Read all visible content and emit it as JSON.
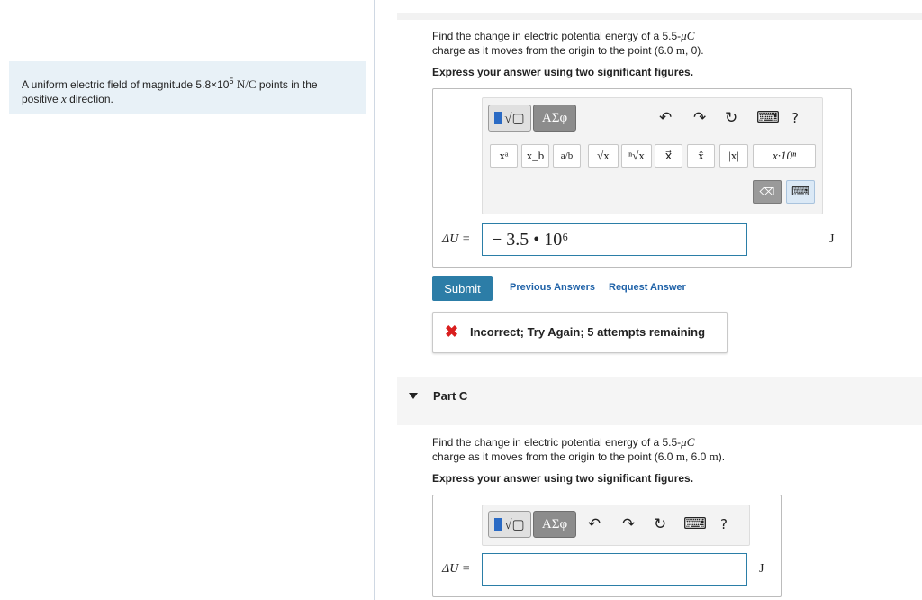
{
  "intro": {
    "text_before": "A uniform electric field of magnitude 5.8×10",
    "exponent": "5",
    "unit": "N/C",
    "text_after": " points in the positive ",
    "variable": "x",
    "text_end": " direction."
  },
  "part_b": {
    "question_line1_pre": "Find the change in electric potential energy of a 5.5-",
    "question_charge_unit": "μC",
    "question_line2_pre": "charge as it moves from the origin to the point (6.0 ",
    "question_m": "m",
    "question_line2_post": ", 0).",
    "instruction": "Express your answer using two significant figures.",
    "toolbar": {
      "format_symbol": "√▢",
      "greek": "ΑΣφ",
      "undo": "↶",
      "redo": "↷",
      "reset": "↻",
      "keyboard": "⌨",
      "help": "?",
      "templates": [
        "xᵃ",
        "x_b",
        "a/b",
        "√x",
        "ⁿ√x",
        "x⃗",
        "x̂",
        "|x|",
        "x·10ⁿ"
      ],
      "delete": "⌫",
      "keyboard_up": "⌨"
    },
    "answer_label": "ΔU =",
    "answer_value": "− 3.5 • 10⁶",
    "answer_unit": "J",
    "submit": "Submit",
    "previous_answers": "Previous Answers",
    "request_answer": "Request Answer",
    "feedback": "Incorrect; Try Again; 5 attempts remaining"
  },
  "part_c": {
    "title": "Part C",
    "question_line1_pre": "Find the change in electric potential energy of a 5.5-",
    "question_charge_unit": "μC",
    "question_line2_pre": "charge as it moves from the origin to the point (6.0 ",
    "question_m1": "m",
    "question_mid": ", 6.0 ",
    "question_m2": "m",
    "question_line2_post": ").",
    "instruction": "Express your answer using two significant figures.",
    "toolbar": {
      "format_symbol": "√▢",
      "greek": "ΑΣφ",
      "undo": "↶",
      "redo": "↷",
      "reset": "↻",
      "keyboard": "⌨",
      "help": "?"
    },
    "answer_label": "ΔU =",
    "answer_value": "",
    "answer_unit": "J"
  },
  "colors": {
    "accent": "#2c7da7",
    "link": "#1f62a8",
    "error": "#d91f1f",
    "intro_bg": "#e8f1f7"
  }
}
